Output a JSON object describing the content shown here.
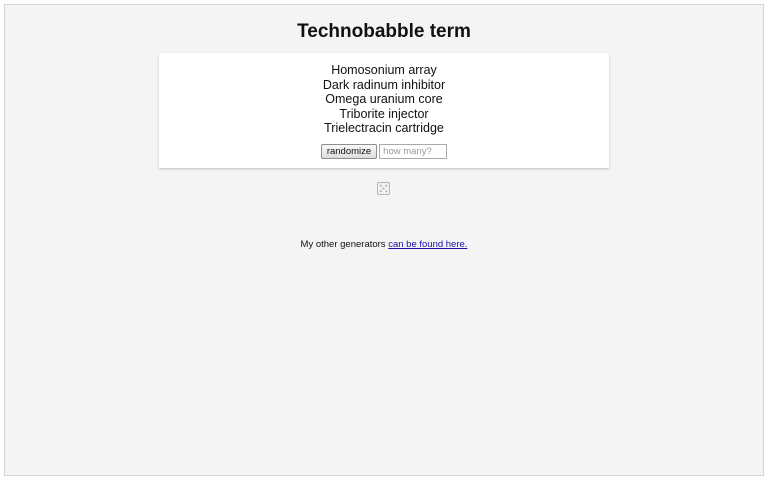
{
  "page": {
    "title": "Technobabble term"
  },
  "results": {
    "items": [
      "Homosonium array",
      "Dark radinum inhibitor",
      "Omega uranium core",
      "Triborite injector",
      "Trielectracin cartridge"
    ]
  },
  "controls": {
    "randomize_label": "randomize",
    "count_placeholder": "how many?",
    "count_value": ""
  },
  "dice": {
    "icon": "dice-icon"
  },
  "footer": {
    "text": "My other generators",
    "link_text": "can be found here."
  }
}
